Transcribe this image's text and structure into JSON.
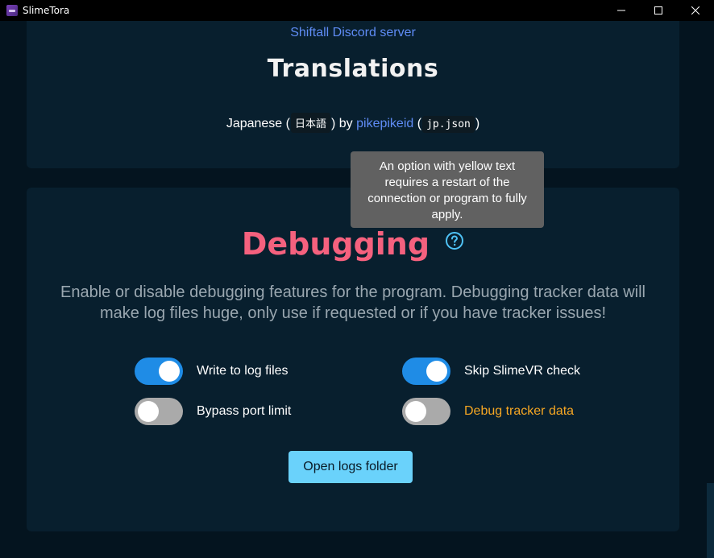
{
  "window": {
    "title": "SlimeTora"
  },
  "translations_card": {
    "discord_link": "Shiftall Discord server",
    "heading": "Translations",
    "entry": {
      "language": "Japanese",
      "open_paren": "(",
      "native_name": "日本語",
      "close_by": ") by",
      "author": "pikepikeid",
      "open_paren2": "(",
      "file": "jp.json",
      "close_paren": ")"
    }
  },
  "debug_card": {
    "heading": "Debugging",
    "help_icon": "question-circle-icon",
    "description": "Enable or disable debugging features for the program. Debugging tracker data will make log files huge, only use if requested or if you have tracker issues!",
    "toggles": [
      {
        "label": "Write to log files",
        "on": true,
        "requires_restart": false
      },
      {
        "label": "Skip SlimeVR check",
        "on": true,
        "requires_restart": false
      },
      {
        "label": "Bypass port limit",
        "on": false,
        "requires_restart": false
      },
      {
        "label": "Debug tracker data",
        "on": false,
        "requires_restart": true
      }
    ],
    "open_logs_label": "Open logs folder"
  },
  "tooltip": {
    "text": "An option with yellow text requires a restart of the connection or program to fully apply."
  },
  "colors": {
    "background": "#04141f",
    "card": "#081f2e",
    "link": "#5f8cf5",
    "debug_heading": "#f5617e",
    "toggle_on": "#1f8ce6",
    "toggle_off": "#aaaaaa",
    "warning": "#f5a623",
    "button": "#6ad2fb",
    "help_icon": "#4fc3f7"
  }
}
